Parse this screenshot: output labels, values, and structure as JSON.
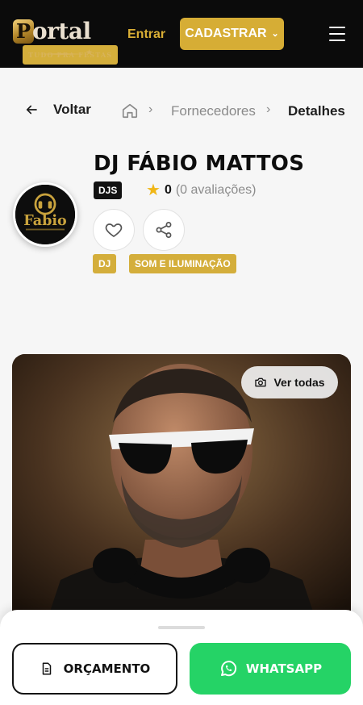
{
  "header": {
    "logo": {
      "word": "ortal",
      "letter": "P",
      "tagline": "TUDO PRA FESTAS"
    },
    "login_label": "Entrar",
    "signup_label": "CADASTRAR",
    "menu_icon": "hamburger-icon"
  },
  "breadcrumb": {
    "back_label": "Voltar",
    "items": [
      "Fornecedores",
      "Detalhes"
    ]
  },
  "profile": {
    "name": "DJ FÁBIO MATTOS",
    "category_badge": "DJS",
    "rating_score": "0",
    "rating_count": "(0 avaliações)",
    "tags": [
      "DJ",
      "SOM E ILUMINAÇÃO"
    ],
    "avatar_text": "Fabio"
  },
  "gallery": {
    "view_all_label": "Ver todas"
  },
  "actions": {
    "quote_label": "ORÇAMENTO",
    "whatsapp_label": "WHATSAPP"
  },
  "colors": {
    "gold": "#d6ad35",
    "whatsapp": "#25d366",
    "dark": "#0b0b0b"
  }
}
